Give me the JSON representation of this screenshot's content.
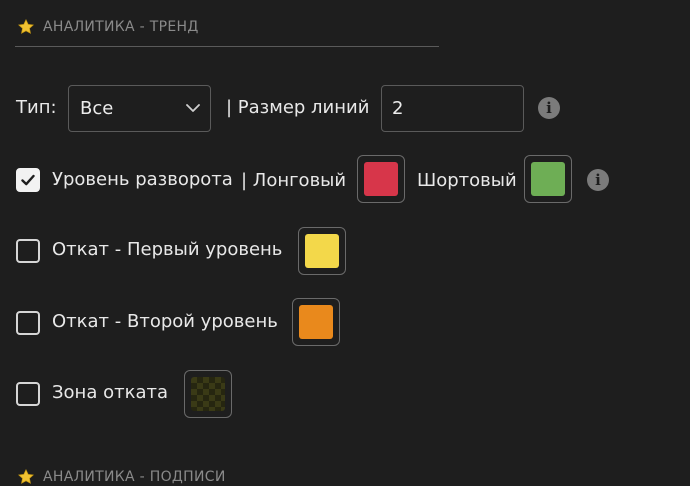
{
  "section_trend": {
    "title": "АНАЛИТИКА - ТРЕНД"
  },
  "type_row": {
    "type_label": "Тип:",
    "type_value": "Все",
    "line_size_label": "| Размер линий",
    "line_size_value": "2"
  },
  "reversal": {
    "label": "Уровень разворота",
    "checked": true,
    "long_label": "| Лонговый",
    "long_color": "#d7364a",
    "short_label": "Шортовый",
    "short_color": "#6eae55"
  },
  "pullback_first": {
    "label": "Откат - Первый уровень",
    "checked": false,
    "color": "#f3d84a"
  },
  "pullback_second": {
    "label": "Откат - Второй уровень",
    "checked": false,
    "color": "#e9891c"
  },
  "pullback_zone": {
    "label": "Зона отката",
    "checked": false,
    "color": "#3a3a16"
  },
  "section_captions": {
    "title": "АНАЛИТИКА - ПОДПИСИ"
  },
  "colors": {
    "star": "#f1c232",
    "background": "#1e1e1e",
    "border": "#5a5a5a"
  }
}
